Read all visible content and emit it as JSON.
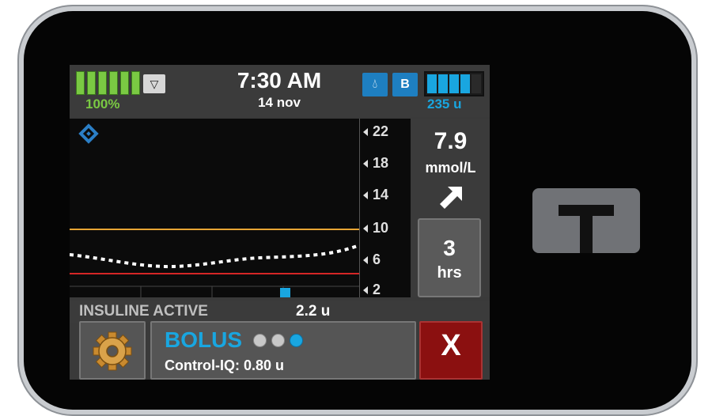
{
  "status": {
    "battery_percent_label": "100%",
    "battery_level": 1.0,
    "signal_icon": "antenna-icon",
    "time": "7:30 AM",
    "date": "14 nov",
    "drop_icon": "droplet-icon",
    "mode_badge": "B",
    "insulin_level": 0.8,
    "insulin_units": "235 u"
  },
  "graph": {
    "y_ticks": [
      "22",
      "18",
      "14",
      "10",
      "6",
      "2"
    ],
    "high_line_value": 10,
    "low_line_value": 3.9,
    "cgm_marker_icon": "cgm-diamond-icon",
    "timeline_marker_color": "#19a6e0"
  },
  "glucose": {
    "value": "7.9",
    "unit": "mmol/L",
    "trend_icon": "arrow-up-right-icon"
  },
  "timeframe": {
    "hours": "3",
    "label": "hrs"
  },
  "active_insulin": {
    "label": "INSULINE ACTIVE",
    "value": "2.2 u"
  },
  "actions": {
    "settings_icon": "gear-icon",
    "bolus_label": "BOLUS",
    "bolus_dots": [
      false,
      false,
      true
    ],
    "control_iq_text": "Control-IQ: 0.80 u",
    "cancel_label": "X"
  },
  "colors": {
    "battery": "#7ac943",
    "insulin": "#19a6e0",
    "high_line": "#e8a534",
    "low_line": "#d42626",
    "cancel": "#8b1010"
  }
}
